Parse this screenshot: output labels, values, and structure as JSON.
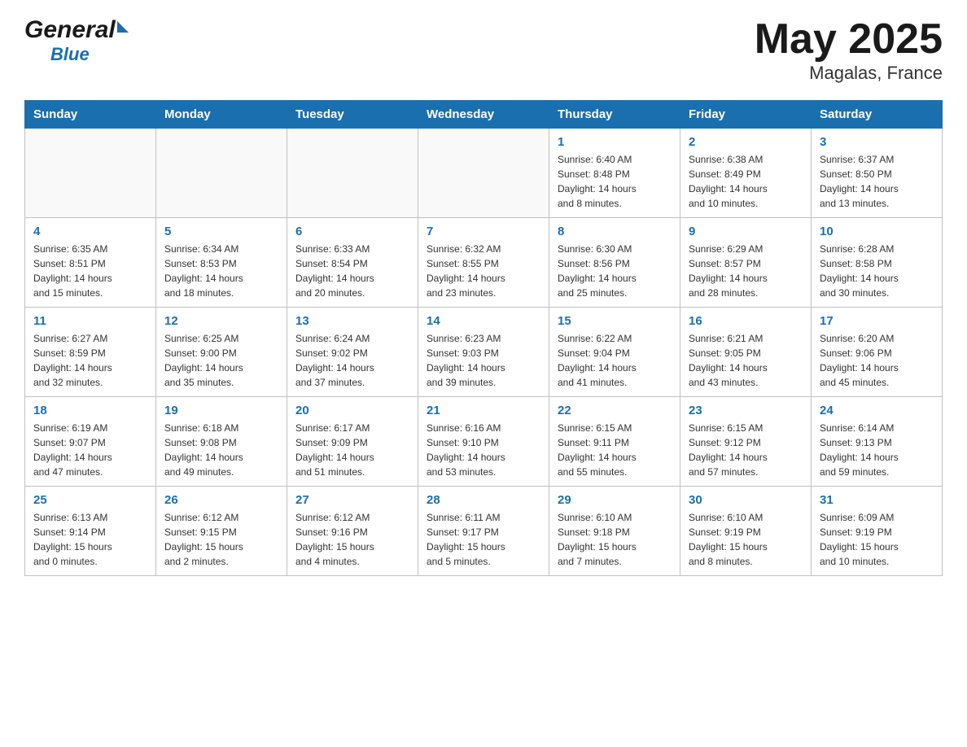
{
  "header": {
    "month_title": "May 2025",
    "location": "Magalas, France",
    "logo_general": "General",
    "logo_blue": "Blue"
  },
  "days_of_week": [
    "Sunday",
    "Monday",
    "Tuesday",
    "Wednesday",
    "Thursday",
    "Friday",
    "Saturday"
  ],
  "weeks": [
    {
      "days": [
        {
          "num": "",
          "info": ""
        },
        {
          "num": "",
          "info": ""
        },
        {
          "num": "",
          "info": ""
        },
        {
          "num": "",
          "info": ""
        },
        {
          "num": "1",
          "info": "Sunrise: 6:40 AM\nSunset: 8:48 PM\nDaylight: 14 hours\nand 8 minutes."
        },
        {
          "num": "2",
          "info": "Sunrise: 6:38 AM\nSunset: 8:49 PM\nDaylight: 14 hours\nand 10 minutes."
        },
        {
          "num": "3",
          "info": "Sunrise: 6:37 AM\nSunset: 8:50 PM\nDaylight: 14 hours\nand 13 minutes."
        }
      ]
    },
    {
      "days": [
        {
          "num": "4",
          "info": "Sunrise: 6:35 AM\nSunset: 8:51 PM\nDaylight: 14 hours\nand 15 minutes."
        },
        {
          "num": "5",
          "info": "Sunrise: 6:34 AM\nSunset: 8:53 PM\nDaylight: 14 hours\nand 18 minutes."
        },
        {
          "num": "6",
          "info": "Sunrise: 6:33 AM\nSunset: 8:54 PM\nDaylight: 14 hours\nand 20 minutes."
        },
        {
          "num": "7",
          "info": "Sunrise: 6:32 AM\nSunset: 8:55 PM\nDaylight: 14 hours\nand 23 minutes."
        },
        {
          "num": "8",
          "info": "Sunrise: 6:30 AM\nSunset: 8:56 PM\nDaylight: 14 hours\nand 25 minutes."
        },
        {
          "num": "9",
          "info": "Sunrise: 6:29 AM\nSunset: 8:57 PM\nDaylight: 14 hours\nand 28 minutes."
        },
        {
          "num": "10",
          "info": "Sunrise: 6:28 AM\nSunset: 8:58 PM\nDaylight: 14 hours\nand 30 minutes."
        }
      ]
    },
    {
      "days": [
        {
          "num": "11",
          "info": "Sunrise: 6:27 AM\nSunset: 8:59 PM\nDaylight: 14 hours\nand 32 minutes."
        },
        {
          "num": "12",
          "info": "Sunrise: 6:25 AM\nSunset: 9:00 PM\nDaylight: 14 hours\nand 35 minutes."
        },
        {
          "num": "13",
          "info": "Sunrise: 6:24 AM\nSunset: 9:02 PM\nDaylight: 14 hours\nand 37 minutes."
        },
        {
          "num": "14",
          "info": "Sunrise: 6:23 AM\nSunset: 9:03 PM\nDaylight: 14 hours\nand 39 minutes."
        },
        {
          "num": "15",
          "info": "Sunrise: 6:22 AM\nSunset: 9:04 PM\nDaylight: 14 hours\nand 41 minutes."
        },
        {
          "num": "16",
          "info": "Sunrise: 6:21 AM\nSunset: 9:05 PM\nDaylight: 14 hours\nand 43 minutes."
        },
        {
          "num": "17",
          "info": "Sunrise: 6:20 AM\nSunset: 9:06 PM\nDaylight: 14 hours\nand 45 minutes."
        }
      ]
    },
    {
      "days": [
        {
          "num": "18",
          "info": "Sunrise: 6:19 AM\nSunset: 9:07 PM\nDaylight: 14 hours\nand 47 minutes."
        },
        {
          "num": "19",
          "info": "Sunrise: 6:18 AM\nSunset: 9:08 PM\nDaylight: 14 hours\nand 49 minutes."
        },
        {
          "num": "20",
          "info": "Sunrise: 6:17 AM\nSunset: 9:09 PM\nDaylight: 14 hours\nand 51 minutes."
        },
        {
          "num": "21",
          "info": "Sunrise: 6:16 AM\nSunset: 9:10 PM\nDaylight: 14 hours\nand 53 minutes."
        },
        {
          "num": "22",
          "info": "Sunrise: 6:15 AM\nSunset: 9:11 PM\nDaylight: 14 hours\nand 55 minutes."
        },
        {
          "num": "23",
          "info": "Sunrise: 6:15 AM\nSunset: 9:12 PM\nDaylight: 14 hours\nand 57 minutes."
        },
        {
          "num": "24",
          "info": "Sunrise: 6:14 AM\nSunset: 9:13 PM\nDaylight: 14 hours\nand 59 minutes."
        }
      ]
    },
    {
      "days": [
        {
          "num": "25",
          "info": "Sunrise: 6:13 AM\nSunset: 9:14 PM\nDaylight: 15 hours\nand 0 minutes."
        },
        {
          "num": "26",
          "info": "Sunrise: 6:12 AM\nSunset: 9:15 PM\nDaylight: 15 hours\nand 2 minutes."
        },
        {
          "num": "27",
          "info": "Sunrise: 6:12 AM\nSunset: 9:16 PM\nDaylight: 15 hours\nand 4 minutes."
        },
        {
          "num": "28",
          "info": "Sunrise: 6:11 AM\nSunset: 9:17 PM\nDaylight: 15 hours\nand 5 minutes."
        },
        {
          "num": "29",
          "info": "Sunrise: 6:10 AM\nSunset: 9:18 PM\nDaylight: 15 hours\nand 7 minutes."
        },
        {
          "num": "30",
          "info": "Sunrise: 6:10 AM\nSunset: 9:19 PM\nDaylight: 15 hours\nand 8 minutes."
        },
        {
          "num": "31",
          "info": "Sunrise: 6:09 AM\nSunset: 9:19 PM\nDaylight: 15 hours\nand 10 minutes."
        }
      ]
    }
  ]
}
